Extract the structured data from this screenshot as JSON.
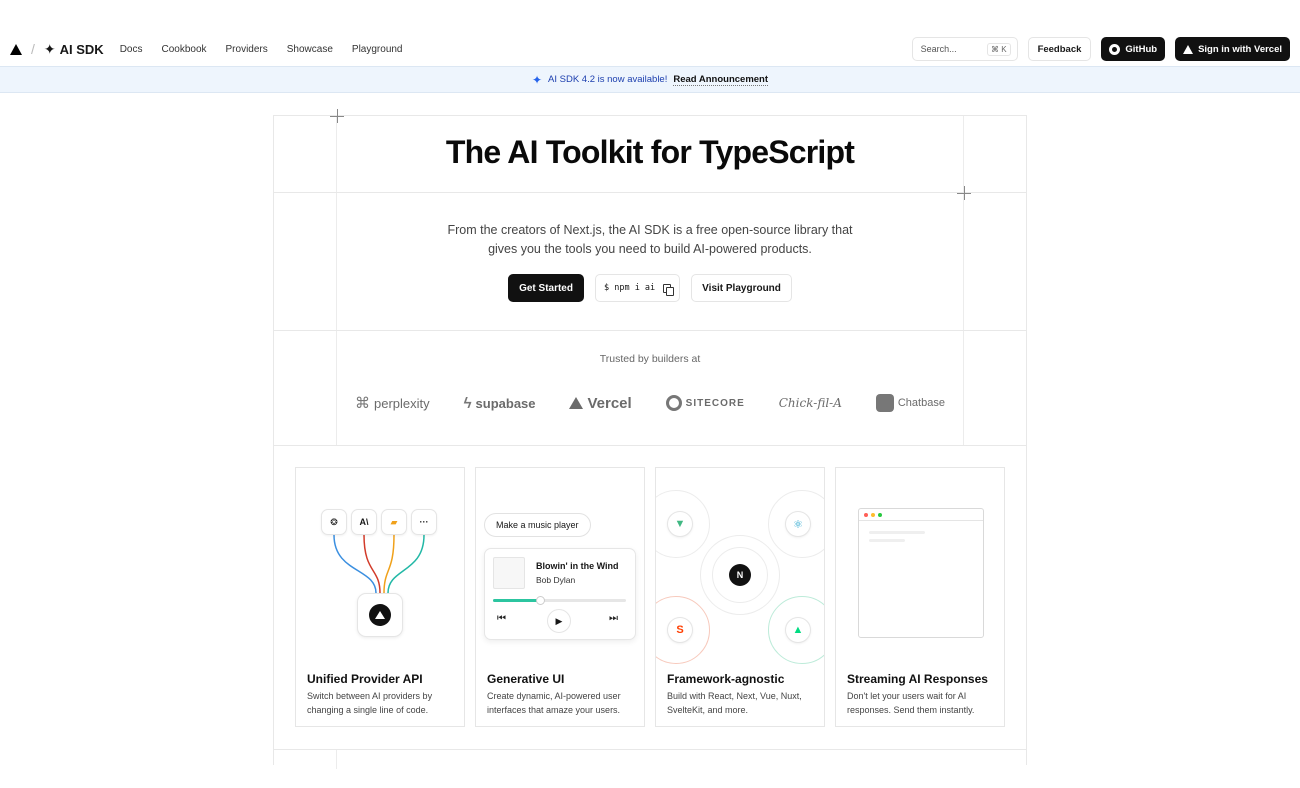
{
  "header": {
    "brand": "AI SDK",
    "nav": [
      "Docs",
      "Cookbook",
      "Providers",
      "Showcase",
      "Playground"
    ],
    "search_placeholder": "Search...",
    "search_shortcut": "⌘ K",
    "feedback": "Feedback",
    "github": "GitHub",
    "signin": "Sign in with Vercel"
  },
  "banner": {
    "message": "AI SDK 4.2 is now available!",
    "link": "Read Announcement"
  },
  "hero": {
    "title": "The AI Toolkit for TypeScript",
    "subtitle_line1": "From the creators of Next.js, the AI SDK is a free open-source library that",
    "subtitle_line2": "gives you the tools you need to build AI-powered products.",
    "get_started": "Get Started",
    "npm": "$ npm i ai",
    "visit_playground": "Visit Playground"
  },
  "trusted": {
    "label": "Trusted by builders at",
    "logos": [
      "perplexity",
      "supabase",
      "Vercel",
      "SITECORE",
      "Chick-fil-A",
      "Chatbase"
    ]
  },
  "cards": [
    {
      "title": "Unified Provider API",
      "desc": "Switch between AI providers by changing a single line of code."
    },
    {
      "title": "Generative UI",
      "desc": "Create dynamic, AI-powered user interfaces that amaze your users."
    },
    {
      "title": "Framework-agnostic",
      "desc": "Build with React, Next, Vue, Nuxt, SvelteKit, and more."
    },
    {
      "title": "Streaming AI Responses",
      "desc": "Don't let your users wait for AI responses. Send them instantly."
    }
  ],
  "provider_card": {
    "icons": [
      "openai-icon",
      "anthropic-icon",
      "mistral-icon",
      "more-icon"
    ],
    "icon_labels": [
      "❂",
      "A\\",
      "▰",
      "···"
    ],
    "wire_colors": [
      "#3b8fe0",
      "#d23b2a",
      "#f0a11a",
      "#22b8a6"
    ]
  },
  "player_card": {
    "prompt": "Make a music player",
    "song": "Blowin' in the Wind",
    "artist": "Bob Dylan",
    "progress": 0.35,
    "accent": "#2cc5a0"
  },
  "framework_card": {
    "center": "N",
    "nodes": [
      "vue-icon",
      "react-icon",
      "svelte-icon",
      "nuxt-icon"
    ],
    "colors": {
      "vue": "#41b883",
      "react": "#149eca",
      "svelte": "#ff3e00",
      "nuxt": "#00dc82"
    }
  }
}
